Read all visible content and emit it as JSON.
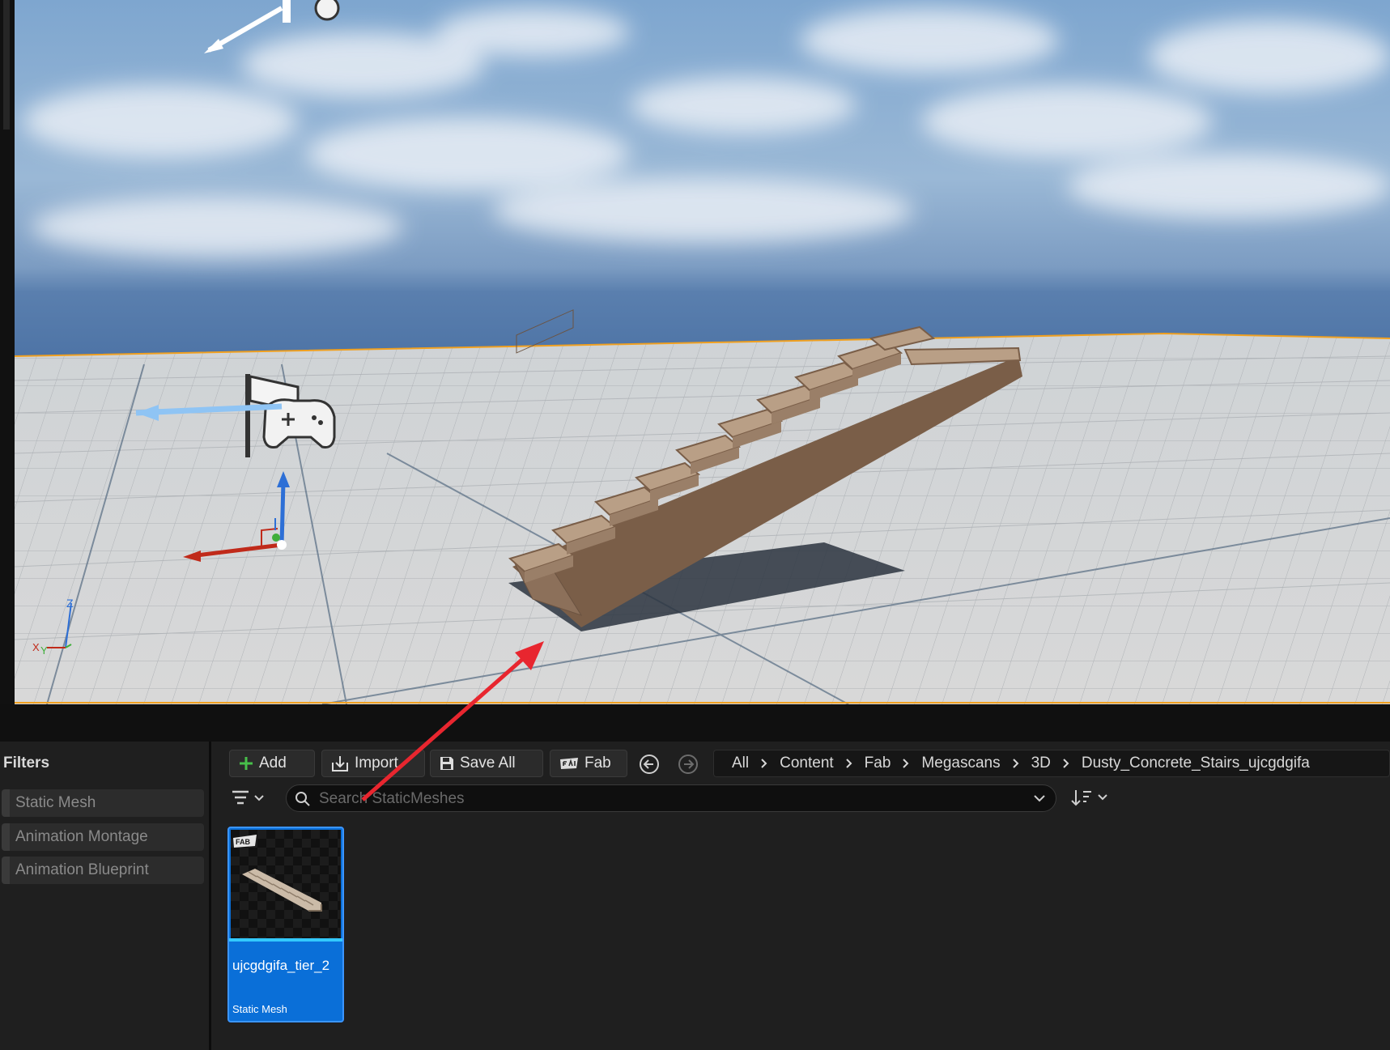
{
  "viewport": {
    "axis_indicator": {
      "z_label": "Z",
      "x_label": "X",
      "y_label": "Y"
    },
    "object": "stairs-mesh"
  },
  "filters": {
    "title": "Filters",
    "items": [
      "Static Mesh",
      "Animation Montage",
      "Animation Blueprint"
    ]
  },
  "toolbar": {
    "add_label": "Add",
    "import_label": "Import",
    "save_all_label": "Save All",
    "fab_label": "Fab"
  },
  "breadcrumb": [
    "All",
    "Content",
    "Fab",
    "Megascans",
    "3D",
    "Dusty_Concrete_Stairs_ujcgdgifa"
  ],
  "search": {
    "placeholder": "Search StaticMeshes",
    "value": ""
  },
  "assets": [
    {
      "name": "ujcgdgifa_tier_2",
      "type": "Static Mesh",
      "badge": "FAB",
      "selected": true
    }
  ],
  "colors": {
    "accent_blue": "#0a6fd8",
    "add_green": "#47c04a",
    "annotation_red": "#e8262f",
    "selection_outline": "#f0a020"
  }
}
